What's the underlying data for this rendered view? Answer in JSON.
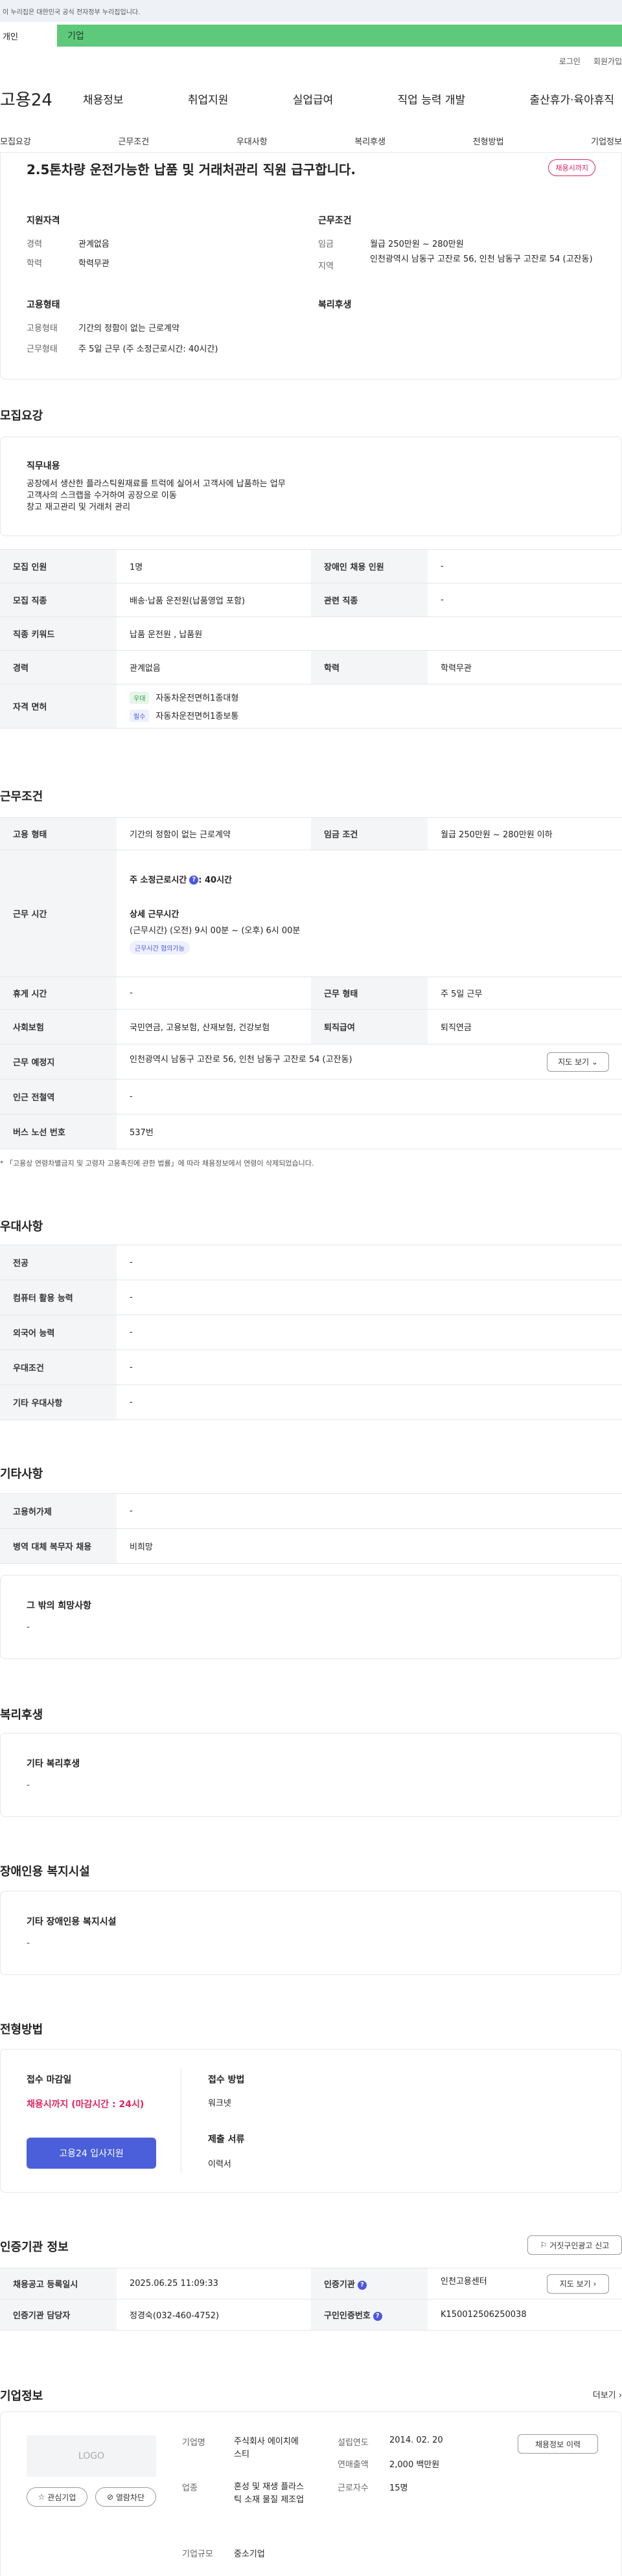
{
  "gov_banner": "이 누리집은 대한민국 공식 전자정부 누리집입니다.",
  "user_tabs": {
    "person": "개인",
    "company": "기업"
  },
  "top_links": {
    "login": "로그인",
    "signup": "회원가입"
  },
  "gnb": {
    "logo": "고용24",
    "menu": [
      "채용정보",
      "취업지원",
      "실업급여",
      "직업 능력 개발",
      "출산휴가·육아휴직"
    ]
  },
  "subnav": [
    "모집요강",
    "근무조건",
    "우대사항",
    "복리후생",
    "전형방법",
    "기업정보"
  ],
  "summary": {
    "title": "2.5톤차량 운전가능한 납품 및 거래처관리 직원 급구합니다.",
    "badge": "채용시까지",
    "qual_heading": "지원자격",
    "qual": [
      {
        "k": "경력",
        "v": "관계없음"
      },
      {
        "k": "학력",
        "v": "학력무관"
      }
    ],
    "work_heading": "근무조건",
    "work": [
      {
        "k": "임금",
        "v": "월급 250만원 ~ 280만원"
      },
      {
        "k": "지역",
        "v": "인천광역시 남동구 고잔로 56, 인천 남동구 고잔로 54 (고잔동)"
      }
    ],
    "emp_heading": "고용형태",
    "emp": [
      {
        "k": "고용형태",
        "v": "기간의 정함이 없는 근로계약"
      },
      {
        "k": "근무형태",
        "v": "주 5일 근무 (주 소정근로시간: 40시간)"
      }
    ],
    "welfare_heading": "복리후생"
  },
  "recruit": {
    "heading": "모집요강",
    "duty_title": "직무내용",
    "duty_lines": [
      "공장에서 생산한 플라스틱원재료를 트럭에 실어서 고객사에 납품하는 업무",
      "고객사의 스크랩을 수거하여 공장으로 이동",
      "창고 재고관리 및 거래처 관리"
    ],
    "rows": {
      "headcount_k": "모집 인원",
      "headcount_v": "1명",
      "disabled_k": "장애인 채용 인원",
      "disabled_v": "-",
      "job_k": "모집 직종",
      "job_v": "배송·납품 운전원(납품영업 포함)",
      "related_k": "관련 직종",
      "related_v": "-",
      "keyword_k": "직종 키워드",
      "keyword_v": "납품 운전원 , 납품원",
      "career_k": "경력",
      "career_v": "관계없음",
      "edu_k": "학력",
      "edu_v": "학력무관",
      "license_k": "자격 면허",
      "licenses": [
        {
          "tag": "우대",
          "name": "자동차운전면허1종대형"
        },
        {
          "tag": "필수",
          "name": "자동차운전면허1종보통"
        }
      ]
    }
  },
  "conditions": {
    "heading": "근무조건",
    "emp_type_k": "고용 형태",
    "emp_type_v": "기간의 정함이 없는 근로계약",
    "wage_k": "임금 조건",
    "wage_v": "월급 250만원 ~ 280만원 이하",
    "hours_k": "근무 시간",
    "hours_weekly": "주 소정근로시간",
    "hours_weekly_v": ": 40시간",
    "hours_detail_title": "상세 근무시간",
    "hours_detail": "(근무시간) (오전) 9시 00분 ~ (오후) 6시 00분",
    "hours_chip": "근무시간 협의가능",
    "rest_k": "휴게 시간",
    "rest_v": "-",
    "work_form_k": "근무 형태",
    "work_form_v": "주 5일 근무",
    "insurance_k": "사회보험",
    "insurance_v": "국민연금, 고용보험, 산재보험, 건강보험",
    "severance_k": "퇴직급여",
    "severance_v": "퇴직연금",
    "location_k": "근무 예정지",
    "location_v": "인천광역시 남동구 고잔로 56, 인천 남동구 고잔로 54 (고잔동)",
    "map_btn": "지도 보기",
    "subway_k": "인근 전철역",
    "subway_v": "-",
    "bus_k": "버스 노선 번호",
    "bus_v": "537번",
    "note": "* 「고용상 연령차별금지 및 고령자 고용촉진에 관한 법률」에 따라 채용정보에서 연령이 삭제되었습니다."
  },
  "preference": {
    "heading": "우대사항",
    "rows": [
      {
        "k": "전공",
        "v": "-"
      },
      {
        "k": "컴퓨터 활용 능력",
        "v": "-"
      },
      {
        "k": "외국어 능력",
        "v": "-"
      },
      {
        "k": "우대조건",
        "v": "-"
      },
      {
        "k": "기타 우대사항",
        "v": "-"
      }
    ]
  },
  "etc": {
    "heading": "기타사항",
    "rows": [
      {
        "k": "고용허가제",
        "v": "-"
      },
      {
        "k": "병역 대체 복무자 채용",
        "v": "비희망"
      }
    ],
    "other_title": "그 밖의 희망사항",
    "other_v": "-"
  },
  "welfare": {
    "heading": "복리후생",
    "title": "기타 복리후생",
    "v": "-"
  },
  "disability": {
    "heading": "장애인용 복지시설",
    "title": "기타 장애인용 복지시설",
    "v": "-"
  },
  "selection": {
    "heading": "전형방법",
    "deadline_title": "접수 마감일",
    "deadline_v": "채용시까지 (마감시간 : 24시)",
    "apply_btn": "고용24 입사지원",
    "method_title": "접수 방법",
    "method_v": "워크넷",
    "docs_title": "제출 서류",
    "docs_v": "이력서"
  },
  "agency": {
    "heading": "인증기관 정보",
    "report_btn": "거짓구인광고 신고",
    "reg_k": "채용공고 등록일시",
    "reg_v": "2025.06.25 11:09:33",
    "org_k": "인증기관",
    "org_v": "인천고용센터",
    "map_btn": "지도 보기",
    "manager_k": "인증기관 담당자",
    "manager_v": "정경숙(032-460-4752)",
    "no_k": "구인인증번호",
    "no_v": "K150012506250038"
  },
  "company": {
    "heading": "기업정보",
    "more": "더보기",
    "logo": "LOGO",
    "fav_btn": "관심기업",
    "block_btn": "열람차단",
    "name_k": "기업명",
    "name_v": "주식회사 에이치에스티",
    "industry_k": "업종",
    "industry_v": "혼성 및 재생 플라스틱 소재 물질 제조업",
    "size_k": "기업규모",
    "size_v": "중소기업",
    "founded_k": "설립연도",
    "founded_v": "2014. 02. 20",
    "sales_k": "연매출액",
    "sales_v": "2,000 백만원",
    "staff_k": "근로자수",
    "staff_v": "15명",
    "other_jobs_btn": "채용정보 이력"
  }
}
